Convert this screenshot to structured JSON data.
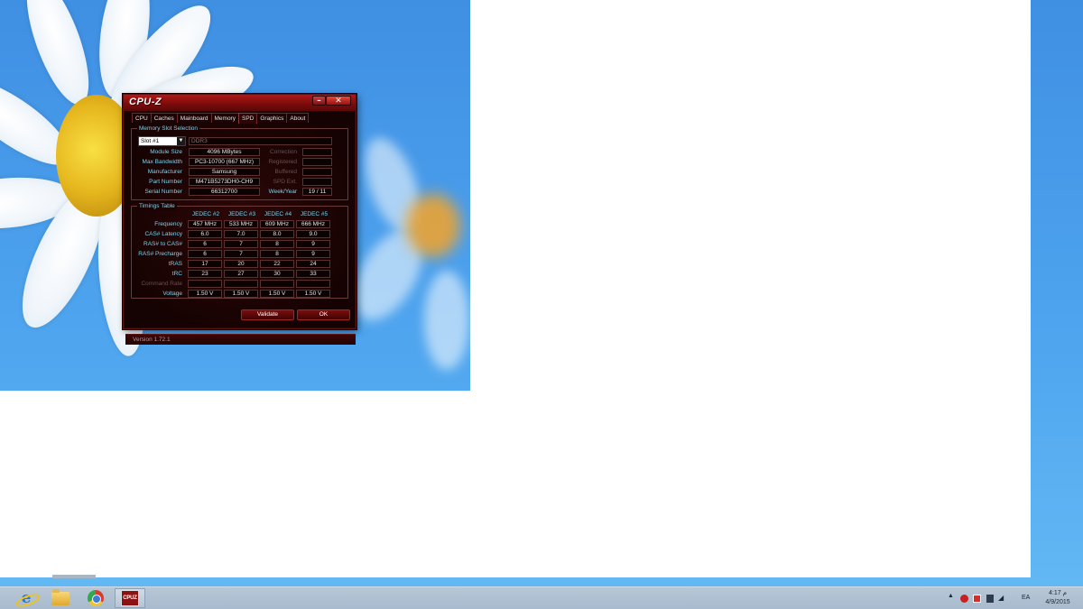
{
  "window": {
    "title": "CPU-Z",
    "minimize_label": "–",
    "close_label": "✕"
  },
  "tabs": [
    "CPU",
    "Caches",
    "Mainboard",
    "Memory",
    "SPD",
    "Graphics",
    "About"
  ],
  "active_tab": "SPD",
  "slot_selection": {
    "group_label": "Memory Slot Selection",
    "slot_value": "Slot #1",
    "memory_type": "DDR3",
    "module_size_label": "Module Size",
    "module_size": "4096 MBytes",
    "max_bandwidth_label": "Max Bandwidth",
    "max_bandwidth": "PC3-10700 (667 MHz)",
    "manufacturer_label": "Manufacturer",
    "manufacturer": "Samsung",
    "part_number_label": "Part Number",
    "part_number": "M471B5273DH0-CH9",
    "serial_number_label": "Serial Number",
    "serial_number": "66312700",
    "correction_label": "Correction",
    "registered_label": "Registered",
    "buffered_label": "Buffered",
    "spd_ext_label": "SPD Ext.",
    "week_year_label": "Week/Year",
    "week_year": "19 / 11"
  },
  "timings": {
    "group_label": "Timings Table",
    "headers": [
      "JEDEC #2",
      "JEDEC #3",
      "JEDEC #4",
      "JEDEC #5"
    ],
    "rows": [
      {
        "label": "Frequency",
        "values": [
          "457 MHz",
          "533 MHz",
          "609 MHz",
          "666 MHz"
        ],
        "dim": false
      },
      {
        "label": "CAS# Latency",
        "values": [
          "6.0",
          "7.0",
          "8.0",
          "9.0"
        ],
        "dim": false
      },
      {
        "label": "RAS# to CAS#",
        "values": [
          "6",
          "7",
          "8",
          "9"
        ],
        "dim": false
      },
      {
        "label": "RAS# Precharge",
        "values": [
          "6",
          "7",
          "8",
          "9"
        ],
        "dim": false
      },
      {
        "label": "tRAS",
        "values": [
          "17",
          "20",
          "22",
          "24"
        ],
        "dim": false
      },
      {
        "label": "tRC",
        "values": [
          "23",
          "27",
          "30",
          "33"
        ],
        "dim": false
      },
      {
        "label": "Command Rate",
        "values": [
          "",
          "",
          "",
          ""
        ],
        "dim": true
      },
      {
        "label": "Voltage",
        "values": [
          "1.50 V",
          "1.50 V",
          "1.50 V",
          "1.50 V"
        ],
        "dim": false
      }
    ]
  },
  "buttons": {
    "validate": "Validate",
    "ok": "OK"
  },
  "version": "Version 1.72.1",
  "taskbar": {
    "apps": [
      {
        "name": "Internet Explorer",
        "icon": "ie-icon"
      },
      {
        "name": "File Explorer",
        "icon": "folder-icon"
      },
      {
        "name": "Google Chrome",
        "icon": "chrome-icon"
      },
      {
        "name": "CPU-Z",
        "icon": "cpuz-icon",
        "active": true,
        "icon_text": "CPUZ"
      }
    ],
    "tray": {
      "language": "EA",
      "time": "4:17 ‏م",
      "date": "4/9/2015"
    }
  }
}
